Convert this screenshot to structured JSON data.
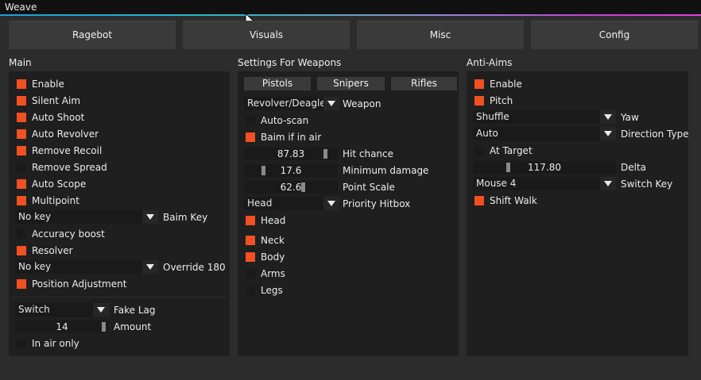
{
  "window": {
    "title": "Weave"
  },
  "tabs": [
    "Ragebot",
    "Visuals",
    "Misc",
    "Config"
  ],
  "main": {
    "title": "Main",
    "enable": "Enable",
    "silent_aim": "Silent Aim",
    "auto_shoot": "Auto Shoot",
    "auto_revolver": "Auto Revolver",
    "remove_recoil": "Remove Recoil",
    "remove_spread": "Remove Spread",
    "auto_scope": "Auto Scope",
    "multipoint": "Multipoint",
    "baim_key_value": "No key",
    "baim_key_label": "Baim Key",
    "accuracy_boost": "Accuracy boost",
    "resolver": "Resolver",
    "override_value": "No key",
    "override_label": "Override 180",
    "position_adjustment": "Position Adjustment",
    "fake_lag_value": "Switch",
    "fake_lag_label": "Fake Lag",
    "amount_value": "14",
    "amount_label": "Amount",
    "in_air_only": "In air only"
  },
  "weapons": {
    "title": "Settings For Weapons",
    "subtabs": [
      "Pistols",
      "Snipers",
      "Rifles"
    ],
    "weapon_value": "Revolver/Deagle",
    "weapon_label": "Weapon",
    "auto_scan": "Auto-scan",
    "baim_if_in_air": "Baim if in air",
    "hit_chance_value": "87.83",
    "hit_chance_label": "Hit chance",
    "min_damage_value": "17.6",
    "min_damage_label": "Minimum damage",
    "point_scale_value": "62.6",
    "point_scale_label": "Point Scale",
    "priority_hitbox_value": "Head",
    "priority_hitbox_label": "Priority Hitbox",
    "head": "Head",
    "neck": "Neck",
    "body": "Body",
    "arms": "Arms",
    "legs": "Legs"
  },
  "antiaim": {
    "title": "Anti-Aims",
    "enable": "Enable",
    "pitch": "Pitch",
    "yaw_value": "Shuffle",
    "yaw_label": "Yaw",
    "direction_value": "Auto",
    "direction_label": "Direction Type",
    "at_target": "At Target",
    "delta_value": "117.80",
    "delta_label": "Delta",
    "switch_key_value": "Mouse 4",
    "switch_key_label": "Switch Key",
    "shift_walk": "Shift Walk"
  },
  "colors": {
    "accent": "#f25022",
    "panel": "#1f1f1f",
    "window": "#2c2c2c",
    "tab": "#3a3a3a"
  }
}
